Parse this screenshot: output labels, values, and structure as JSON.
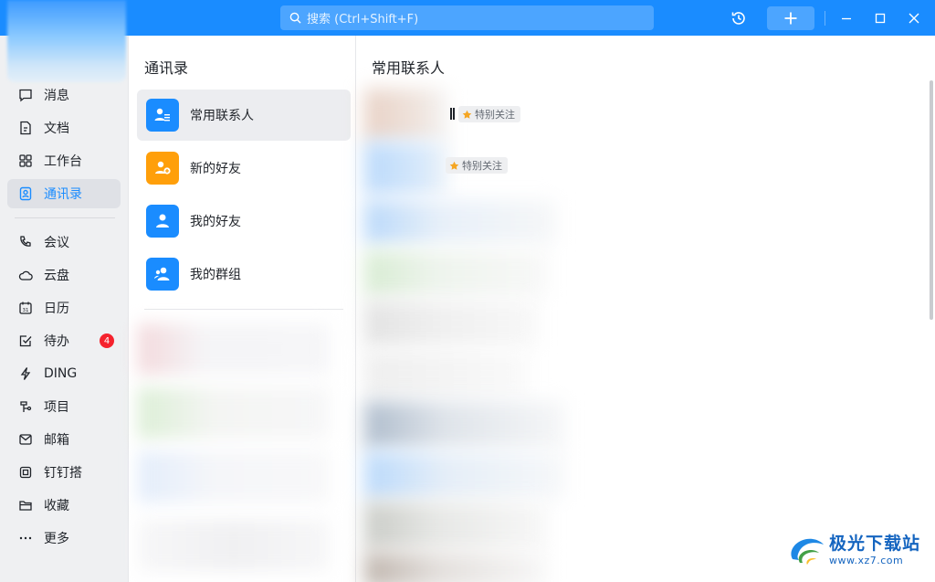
{
  "search": {
    "placeholder": "搜索 (Ctrl+Shift+F)"
  },
  "sidebar": {
    "items": [
      {
        "label": "消息",
        "icon": "chat-icon"
      },
      {
        "label": "文档",
        "icon": "document-icon"
      },
      {
        "label": "工作台",
        "icon": "grid-icon"
      },
      {
        "label": "通讯录",
        "icon": "contacts-icon",
        "active": true
      },
      {
        "label": "会议",
        "icon": "phone-icon"
      },
      {
        "label": "云盘",
        "icon": "cloud-icon"
      },
      {
        "label": "日历",
        "icon": "calendar-icon"
      },
      {
        "label": "待办",
        "icon": "todo-icon",
        "badge": "4"
      },
      {
        "label": "DING",
        "icon": "lightning-icon"
      },
      {
        "label": "项目",
        "icon": "project-icon"
      },
      {
        "label": "邮箱",
        "icon": "mail-icon"
      },
      {
        "label": "钉钉搭",
        "icon": "builder-icon"
      },
      {
        "label": "收藏",
        "icon": "folder-icon"
      },
      {
        "label": "更多",
        "icon": "more-icon"
      }
    ]
  },
  "contacts_panel": {
    "title": "通讯录",
    "items": [
      {
        "label": "常用联系人",
        "icon": "frequent-contacts-icon",
        "color": "#1a8cff",
        "active": true
      },
      {
        "label": "新的好友",
        "icon": "new-friend-icon",
        "color": "#ff9f0a"
      },
      {
        "label": "我的好友",
        "icon": "my-friends-icon",
        "color": "#1a8cff"
      },
      {
        "label": "我的群组",
        "icon": "my-groups-icon",
        "color": "#1a8cff"
      }
    ]
  },
  "main": {
    "title": "常用联系人",
    "contacts": [
      {
        "tag": "特别关注"
      },
      {
        "tag": "特别关注"
      }
    ]
  },
  "watermark": {
    "text": "极光下载站",
    "url": "www.xz7.com"
  },
  "colors": {
    "accent": "#1a8cff",
    "orange": "#ff9f0a",
    "badge": "#f5222d",
    "star": "#f5a623"
  }
}
